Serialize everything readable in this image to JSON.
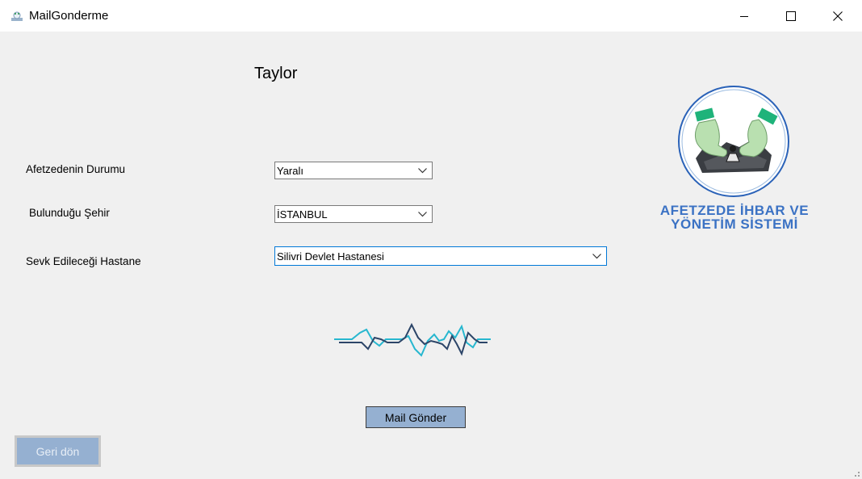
{
  "window": {
    "title": "MailGonderme",
    "icon": "app-icon",
    "controls": [
      "minimize-icon",
      "maximize-icon",
      "close-icon"
    ]
  },
  "form": {
    "heading": "Taylor",
    "status_label": "Afetzedenin Durumu",
    "status_value": "Yaralı",
    "city_label": "Bulunduğu Şehir",
    "city_value": "İSTANBUL",
    "hospital_label": "Sevk Edileceği Hastane",
    "hospital_value": "Silivri Devlet Hastanesi"
  },
  "logo": {
    "line1": "AFETZEDE İHBAR VE",
    "line2": "YÖNETİM SİSTEMİ",
    "colors": {
      "ring": "#2a62b8",
      "text": "#3b72c4",
      "glove": "#b9e0b0",
      "cuff": "#1fb37a"
    }
  },
  "buttons": {
    "send": "Mail Gönder",
    "back": "Geri dön"
  },
  "colors": {
    "button_fill": "#95b0d1",
    "focus_border": "#0078d7",
    "wave_dark": "#2c4568",
    "wave_light": "#27b7cf"
  }
}
